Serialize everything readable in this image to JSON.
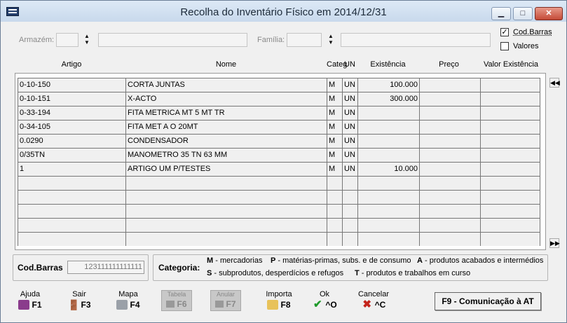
{
  "window": {
    "title": "Recolha do Inventário Físico em 2014/12/31"
  },
  "filters": {
    "armazem_label": "Armazém:",
    "familia_label": "Família:",
    "cod_barras_label": "Cod.Barras",
    "cod_barras_checked": true,
    "valores_label": "Valores",
    "valores_checked": false
  },
  "table": {
    "columns": [
      "Artigo",
      "Nome",
      "Categ",
      "UN",
      "Existência",
      "Preço",
      "Valor Existência"
    ],
    "rows": [
      {
        "artigo": "0-10-150",
        "nome": "CORTA JUNTAS",
        "categ": "M",
        "un": "UN",
        "existencia": "100.000",
        "preco": "",
        "valor": ""
      },
      {
        "artigo": "0-10-151",
        "nome": "X-ACTO",
        "categ": "M",
        "un": "UN",
        "existencia": "300.000",
        "preco": "",
        "valor": ""
      },
      {
        "artigo": "0-33-194",
        "nome": "FITA METRICA MT  5 MT TR",
        "categ": "M",
        "un": "UN",
        "existencia": "",
        "preco": "",
        "valor": ""
      },
      {
        "artigo": "0-34-105",
        "nome": "FITA MET A O 20MT",
        "categ": "M",
        "un": "UN",
        "existencia": "",
        "preco": "",
        "valor": ""
      },
      {
        "artigo": "0.0290",
        "nome": "CONDENSADOR",
        "categ": "M",
        "un": "UN",
        "existencia": "",
        "preco": "",
        "valor": ""
      },
      {
        "artigo": "0/35TN",
        "nome": "MANOMETRO 35 TN 63 MM",
        "categ": "M",
        "un": "UN",
        "existencia": "",
        "preco": "",
        "valor": ""
      },
      {
        "artigo": "1",
        "nome": "ARTIGO UM P/TESTES",
        "categ": "M",
        "un": "UN",
        "existencia": "10.000",
        "preco": "",
        "valor": ""
      },
      {
        "artigo": "",
        "nome": "",
        "categ": "",
        "un": "",
        "existencia": "",
        "preco": "",
        "valor": ""
      },
      {
        "artigo": "",
        "nome": "",
        "categ": "",
        "un": "",
        "existencia": "",
        "preco": "",
        "valor": ""
      },
      {
        "artigo": "",
        "nome": "",
        "categ": "",
        "un": "",
        "existencia": "",
        "preco": "",
        "valor": ""
      },
      {
        "artigo": "",
        "nome": "",
        "categ": "",
        "un": "",
        "existencia": "",
        "preco": "",
        "valor": ""
      },
      {
        "artigo": "",
        "nome": "",
        "categ": "",
        "un": "",
        "existencia": "",
        "preco": "",
        "valor": ""
      }
    ]
  },
  "barcode": {
    "label": "Cod.Barras",
    "value": "123111111111111"
  },
  "categoria": {
    "label": "Categoria:",
    "items": [
      {
        "code": "M",
        "text": "- mercadorias"
      },
      {
        "code": "P",
        "text": "- matérias-primas, subs. e de consumo"
      },
      {
        "code": "A",
        "text": "- produtos acabados e intermédios"
      },
      {
        "code": "S",
        "text": "- subprodutos, desperdícios e refugos"
      },
      {
        "code": "T",
        "text": "- produtos e trabalhos em curso"
      }
    ]
  },
  "toolbar": {
    "ajuda": {
      "label": "Ajuda",
      "key": "F1"
    },
    "sair": {
      "label": "Sair",
      "key": "F3"
    },
    "mapa": {
      "label": "Mapa",
      "key": "F4"
    },
    "tabela": {
      "label": "Tabela",
      "key": "F6"
    },
    "anular": {
      "label": "Anular",
      "key": "F7"
    },
    "importa": {
      "label": "Importa",
      "key": "F8"
    },
    "ok": {
      "label": "Ok",
      "key": "^O"
    },
    "cancelar": {
      "label": "Cancelar",
      "key": "^C"
    },
    "comunicacao": "F9 - Comunicação à AT"
  }
}
